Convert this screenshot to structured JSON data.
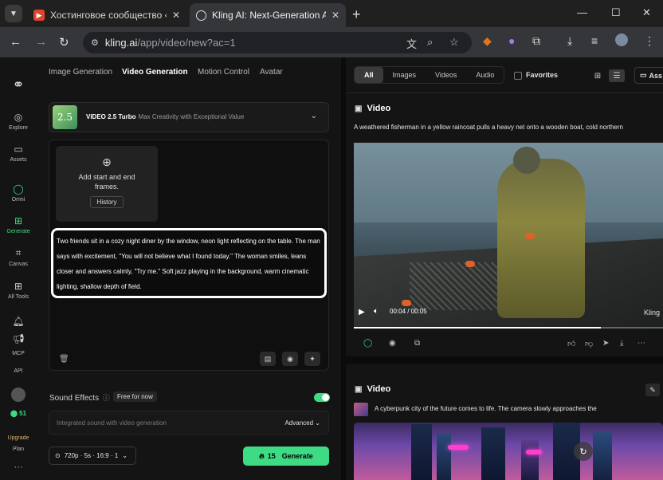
{
  "browser": {
    "tabs": [
      {
        "title": "Хостинговое сообщество «Tim"
      },
      {
        "title": "Kling AI: Next-Generation AI Cr"
      }
    ],
    "url_host": "kling.ai",
    "url_path": "/app/video/new?ac=1"
  },
  "sidebar": {
    "items": [
      {
        "label": "Explore"
      },
      {
        "label": "Assets"
      },
      {
        "label": "Omni"
      },
      {
        "label": "Generate"
      },
      {
        "label": "Canvas"
      },
      {
        "label": "All Tools"
      },
      {
        "label": "MCP"
      },
      {
        "label": "API"
      },
      {
        "label": "51"
      },
      {
        "label": "Upgrade"
      },
      {
        "label": "Plan"
      }
    ]
  },
  "left": {
    "mode_tabs": [
      "Image Generation",
      "Video Generation",
      "Motion Control",
      "Avatar"
    ],
    "active_mode": "Video Generation",
    "model": {
      "thumb_text": "2.5",
      "thumb_sub": "Turbo",
      "name": "VIDEO 2.5 Turbo",
      "desc": "Max Creativity with Exceptional Value"
    },
    "frames": {
      "label": "Add start and end frames.",
      "history_label": "History"
    },
    "prompt": "Two friends sit in a cozy night diner by the window, neon light reflecting on the table. The man says with excitement, \"You will not believe what I found today.\" The woman smiles, leans closer and answers calmly, \"Try me.\" Soft jazz playing in the background, warm cinematic lighting, shallow depth of field.",
    "sound": {
      "label": "Sound Effects",
      "badge": "Free for now",
      "placeholder": "Integrated sound with video generation",
      "advanced_label": "Advanced"
    },
    "settings_label": "720p · 5s · 16:9 · 1",
    "generate": {
      "credits": "15",
      "label": "Generate"
    }
  },
  "right": {
    "filters": [
      "All",
      "Images",
      "Videos",
      "Audio"
    ],
    "active_filter": "All",
    "favorites_label": "Favorites",
    "assets_label": "Ass",
    "items": [
      {
        "title": "Video",
        "prompt": "A weathered fisherman in a yellow raincoat pulls a heavy net onto a wooden boat, cold northern",
        "time": "00:04 / 00:05",
        "progress": 0.8,
        "watermark": "Kling"
      },
      {
        "title": "Video",
        "prompt": "A cyberpunk city of the future comes to life. The camera slowly approaches the"
      }
    ]
  }
}
